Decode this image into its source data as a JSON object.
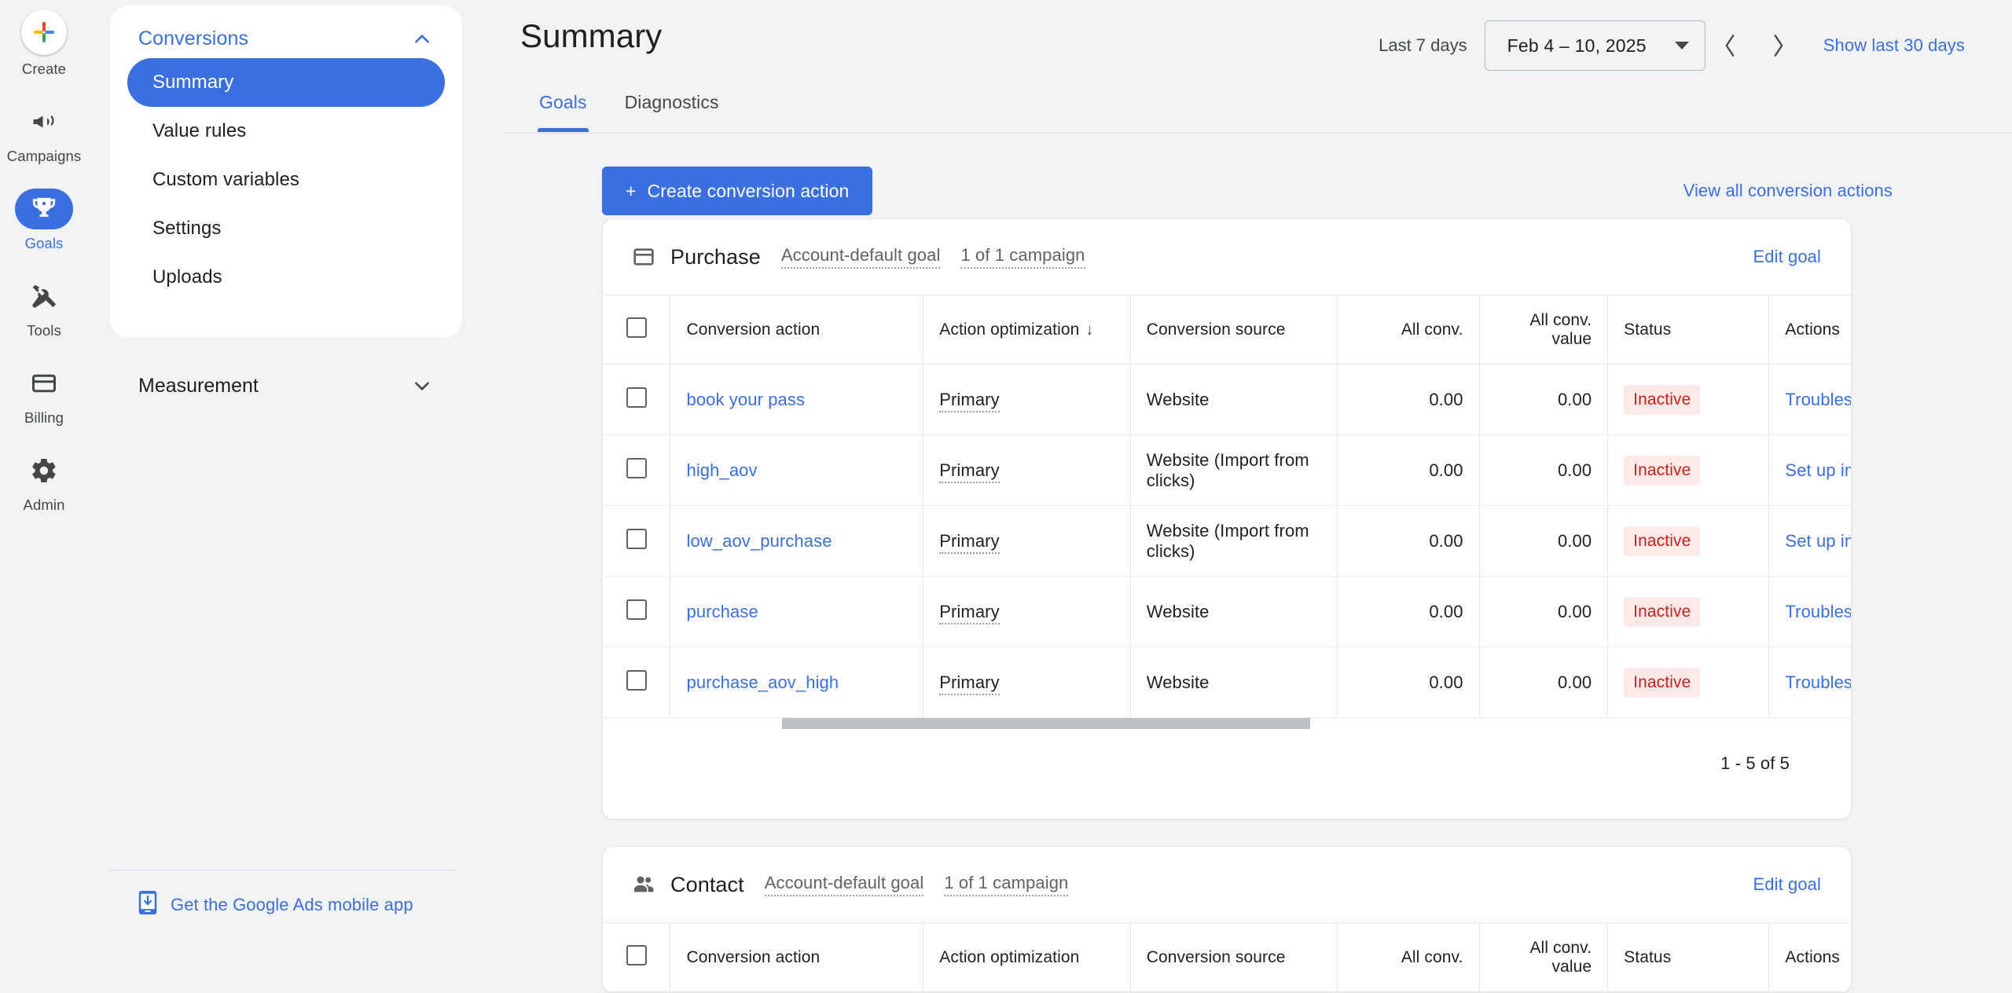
{
  "rail": {
    "items": [
      {
        "label": "Create",
        "icon": "google-plus-icon",
        "active": false
      },
      {
        "label": "Campaigns",
        "icon": "megaphone-icon",
        "active": false
      },
      {
        "label": "Goals",
        "icon": "trophy-icon",
        "active": true
      },
      {
        "label": "Tools",
        "icon": "tools-icon",
        "active": false
      },
      {
        "label": "Billing",
        "icon": "credit-card-icon",
        "active": false
      },
      {
        "label": "Admin",
        "icon": "gear-icon",
        "active": false
      }
    ]
  },
  "nav": {
    "section_title": "Conversions",
    "items": [
      {
        "label": "Summary",
        "selected": true
      },
      {
        "label": "Value rules",
        "selected": false
      },
      {
        "label": "Custom variables",
        "selected": false
      },
      {
        "label": "Settings",
        "selected": false
      },
      {
        "label": "Uploads",
        "selected": false
      }
    ],
    "group_title": "Measurement",
    "mobile_app_label": "Get the Google Ads mobile app"
  },
  "header": {
    "title": "Summary",
    "date_preset": "Last 7 days",
    "date_range": "Feb 4 – 10, 2025",
    "prev_label": "‹",
    "next_label": "›",
    "show_last_30": "Show last 30 days"
  },
  "tabs": [
    {
      "label": "Goals",
      "active": true
    },
    {
      "label": "Diagnostics",
      "active": false
    }
  ],
  "toolbar": {
    "create_label": "Create conversion action",
    "create_plus": "+",
    "view_all_label": "View all conversion actions"
  },
  "table_columns": [
    "Conversion action",
    "Action optimization",
    "Conversion source",
    "All conv.",
    "All conv. value",
    "Status",
    "Actions"
  ],
  "sort_indicator": "↓",
  "cards": [
    {
      "icon": "credit-card-icon",
      "title": "Purchase",
      "goal_type": "Account-default goal",
      "campaign_count": "1 of 1 campaign",
      "edit_label": "Edit goal",
      "rows": [
        {
          "name": "book your pass",
          "optimization": "Primary",
          "source": "Website",
          "all_conv": "0.00",
          "all_conv_value": "0.00",
          "status": "Inactive",
          "action": "Troubleshoot"
        },
        {
          "name": "high_aov",
          "optimization": "Primary",
          "source": "Website (Import from clicks)",
          "all_conv": "0.00",
          "all_conv_value": "0.00",
          "status": "Inactive",
          "action": "Set up import"
        },
        {
          "name": "low_aov_purchase",
          "optimization": "Primary",
          "source": "Website (Import from clicks)",
          "all_conv": "0.00",
          "all_conv_value": "0.00",
          "status": "Inactive",
          "action": "Set up import"
        },
        {
          "name": "purchase",
          "optimization": "Primary",
          "source": "Website",
          "all_conv": "0.00",
          "all_conv_value": "0.00",
          "status": "Inactive",
          "action": "Troubleshoot"
        },
        {
          "name": "purchase_aov_high",
          "optimization": "Primary",
          "source": "Website",
          "all_conv": "0.00",
          "all_conv_value": "0.00",
          "status": "Inactive",
          "action": "Troubleshoot"
        }
      ],
      "pager": "1 - 5 of 5"
    },
    {
      "icon": "people-icon",
      "title": "Contact",
      "goal_type": "Account-default goal",
      "campaign_count": "1 of 1 campaign",
      "edit_label": "Edit goal",
      "rows": [],
      "pager": ""
    }
  ],
  "colors": {
    "accent": "#3b6fe0",
    "status_bg": "#fce8e6",
    "status_fg": "#c5221f",
    "page_bg": "#f1f3f4"
  }
}
